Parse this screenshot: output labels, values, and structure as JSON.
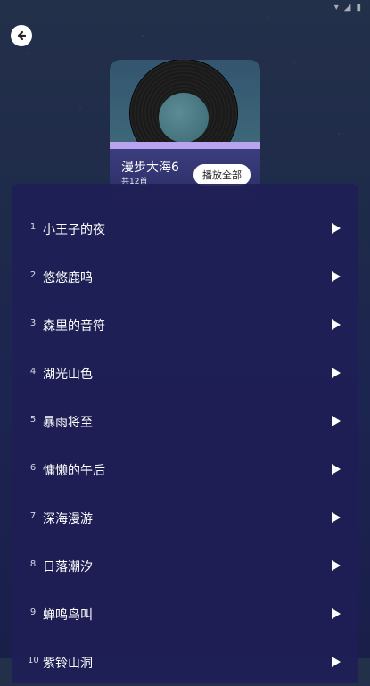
{
  "album": {
    "title": "漫步大海6",
    "count": "共12首",
    "play_all_label": "播放全部"
  },
  "tracks": [
    {
      "index": "1",
      "title": "小王子的夜"
    },
    {
      "index": "2",
      "title": "悠悠鹿鸣"
    },
    {
      "index": "3",
      "title": "森里的音符"
    },
    {
      "index": "4",
      "title": "湖光山色"
    },
    {
      "index": "5",
      "title": "暴雨将至"
    },
    {
      "index": "6",
      "title": "慵懒的午后"
    },
    {
      "index": "7",
      "title": "深海漫游"
    },
    {
      "index": "8",
      "title": "日落潮汐"
    },
    {
      "index": "9",
      "title": "蝉鸣鸟叫"
    },
    {
      "index": "10",
      "title": "紫铃山洞"
    }
  ],
  "colors": {
    "accent_bar": "#b9a2f0",
    "panel_bg": "#1e1e55",
    "button_bg": "#ffffff"
  },
  "icons": {
    "back": "arrow-left-icon",
    "play": "play-icon"
  }
}
